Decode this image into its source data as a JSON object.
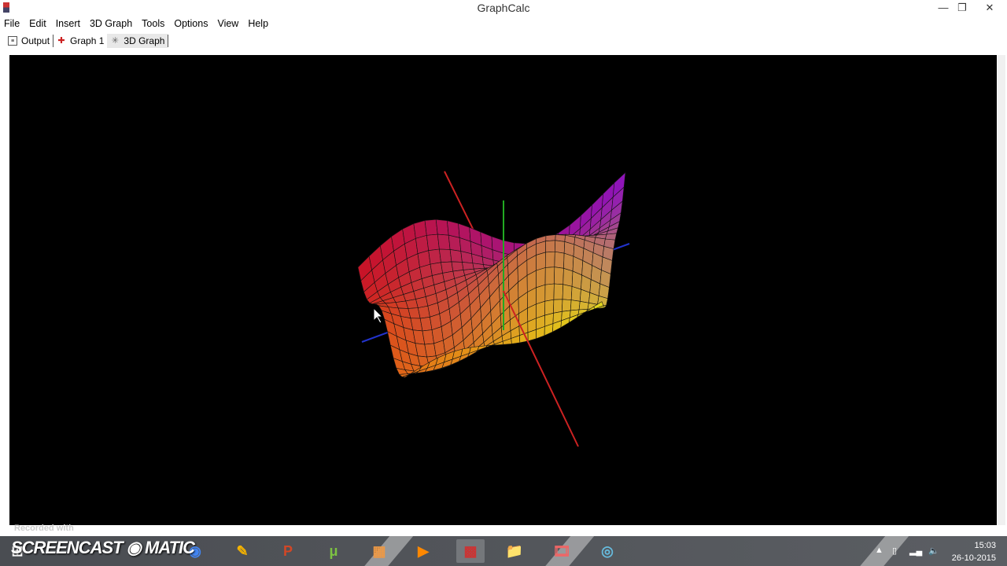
{
  "window": {
    "title": "GraphCalc"
  },
  "menu": [
    "File",
    "Edit",
    "Insert",
    "3D Graph",
    "Tools",
    "Options",
    "View",
    "Help"
  ],
  "tabs": [
    {
      "label": "Output",
      "icon": "output-icon"
    },
    {
      "label": "Graph 1",
      "icon": "graph-icon"
    },
    {
      "label": "3D Graph",
      "icon": "3d-graph-icon",
      "active": true
    }
  ],
  "watermark": {
    "recorded": "Recorded with",
    "brand": "SCREENCAST-O-MATIC"
  },
  "taskbar": {
    "apps": [
      "chrome",
      "sketch",
      "powerpoint",
      "utorrent",
      "apps",
      "media-player",
      "graphcalc",
      "file-explorer",
      "movie-maker",
      "cortana-circle"
    ]
  },
  "clock": {
    "time": "15:03",
    "date": "26-10-2015"
  },
  "colors": {
    "canvas": "#000000",
    "x_axis": "#cc2222",
    "y_axis": "#2233cc",
    "z_axis": "#22aa22"
  }
}
